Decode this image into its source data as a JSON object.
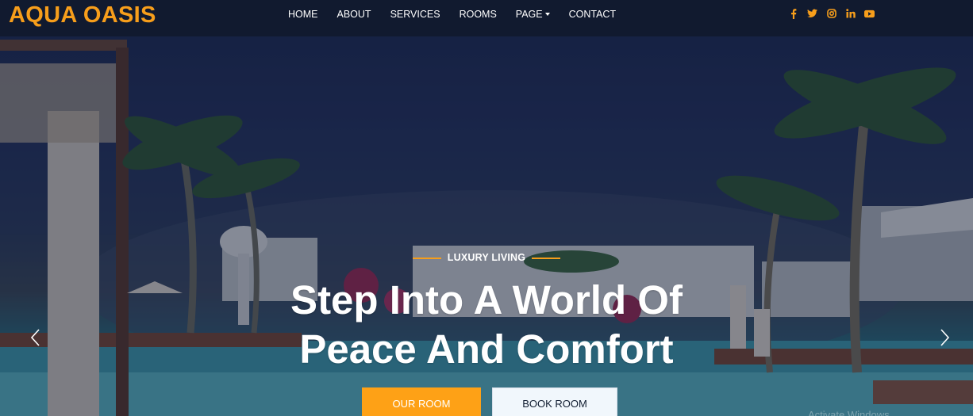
{
  "brand": {
    "name": "AQUA OASIS",
    "color": "#f79e1b"
  },
  "nav": {
    "items": [
      {
        "label": "HOME"
      },
      {
        "label": "ABOUT"
      },
      {
        "label": "SERVICES"
      },
      {
        "label": "ROOMS"
      },
      {
        "label": "PAGE"
      },
      {
        "label": "CONTACT"
      }
    ]
  },
  "social": [
    {
      "icon": "facebook-icon"
    },
    {
      "icon": "twitter-icon"
    },
    {
      "icon": "instagram-icon"
    },
    {
      "icon": "linkedin-icon"
    },
    {
      "icon": "youtube-icon"
    }
  ],
  "hero": {
    "eyebrow": "LUXURY LIVING",
    "headline_line1": "Step Into A World Of",
    "headline_line2": "Peace And Comfort",
    "primary_button": "OUR ROOM",
    "secondary_button": "BOOK ROOM",
    "watermark": "Activate Windows"
  },
  "colors": {
    "accent": "#fea116",
    "navbar": "#111a2f",
    "light_button": "#f1f7fc"
  }
}
